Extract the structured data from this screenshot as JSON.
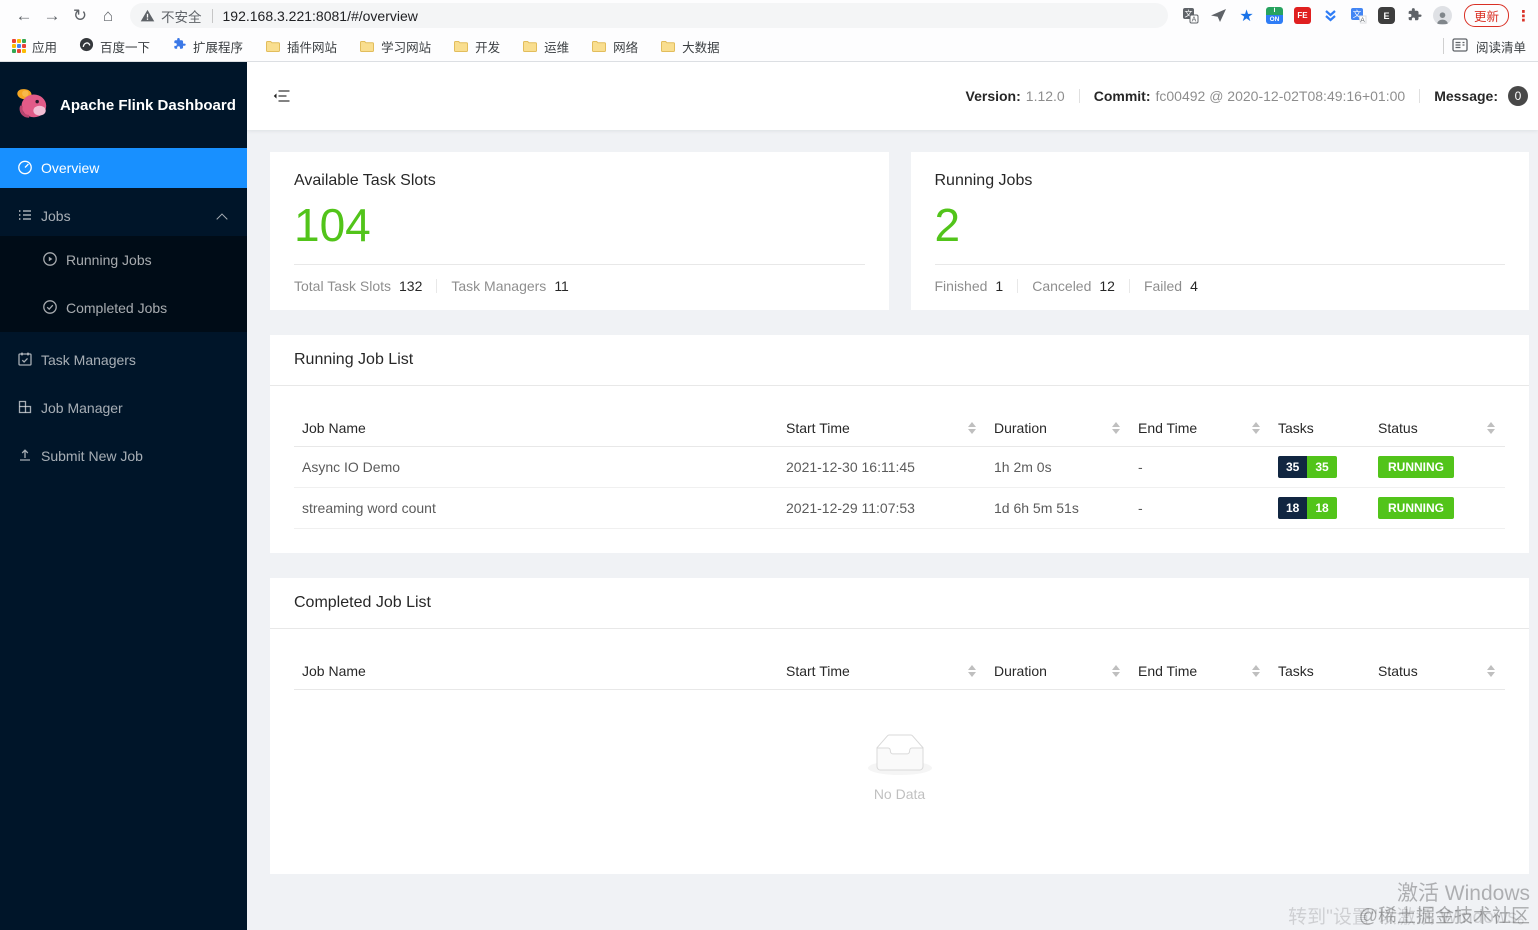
{
  "browser": {
    "nav": {
      "back": "←",
      "forward": "→",
      "reload": "↻",
      "home": "⌂"
    },
    "security_label": "不安全",
    "url": "192.168.3.221:8081/#/overview",
    "itab_top": "i",
    "itab_bottom": "ON",
    "fe_label": "FE",
    "evernote_label": "E",
    "update_button": "更新",
    "more_glyph": "⋮",
    "star_glyph": "★",
    "bookmarks": [
      "应用",
      "百度一下",
      "扩展程序",
      "插件网站",
      "学习网站",
      "开发",
      "运维",
      "网络",
      "大数据"
    ],
    "reading_list_label": "阅读清单"
  },
  "sidebar": {
    "title": "Apache Flink Dashboard",
    "overview": "Overview",
    "jobs": "Jobs",
    "running_jobs": "Running Jobs",
    "completed_jobs": "Completed Jobs",
    "task_managers": "Task Managers",
    "job_manager": "Job Manager",
    "submit_new_job": "Submit New Job"
  },
  "header": {
    "version_label": "Version:",
    "version_value": "1.12.0",
    "commit_label": "Commit:",
    "commit_value": "fc00492 @ 2020-12-02T08:49:16+01:00",
    "message_label": "Message:",
    "message_count": "0"
  },
  "stats": {
    "available": {
      "title": "Available Task Slots",
      "value": "104",
      "f1_label": "Total Task Slots",
      "f1_value": "132",
      "f2_label": "Task Managers",
      "f2_value": "11"
    },
    "running": {
      "title": "Running Jobs",
      "value": "2",
      "f1_label": "Finished",
      "f1_value": "1",
      "f2_label": "Canceled",
      "f2_value": "12",
      "f3_label": "Failed",
      "f3_value": "4"
    }
  },
  "running_list": {
    "title": "Running Job List",
    "columns": [
      "Job Name",
      "Start Time",
      "Duration",
      "End Time",
      "Tasks",
      "Status"
    ],
    "rows": [
      {
        "name": "Async IO Demo",
        "start_time": "2021-12-30 16:11:45",
        "duration": "1h 2m 0s",
        "end_time": "-",
        "tasks_total": "35",
        "tasks_running": "35",
        "status": "RUNNING"
      },
      {
        "name": "streaming word count",
        "start_time": "2021-12-29 11:07:53",
        "duration": "1d 6h 5m 51s",
        "end_time": "-",
        "tasks_total": "18",
        "tasks_running": "18",
        "status": "RUNNING"
      }
    ]
  },
  "completed_list": {
    "title": "Completed Job List",
    "columns": [
      "Job Name",
      "Start Time",
      "Duration",
      "End Time",
      "Tasks",
      "Status"
    ],
    "empty_text": "No Data"
  },
  "watermark": {
    "line1": "激活 Windows",
    "line2": "@稀土掘金技术社区",
    "line2_under": "转到\"设置\"以激活 Windows。"
  },
  "colors": {
    "accent": "#1890ff",
    "success_green": "#52c41a",
    "sidebar_bg": "#001529",
    "submenu_bg": "#000c17",
    "tasks_badge_dark": "#112641",
    "chrome_red": "#d93025"
  }
}
